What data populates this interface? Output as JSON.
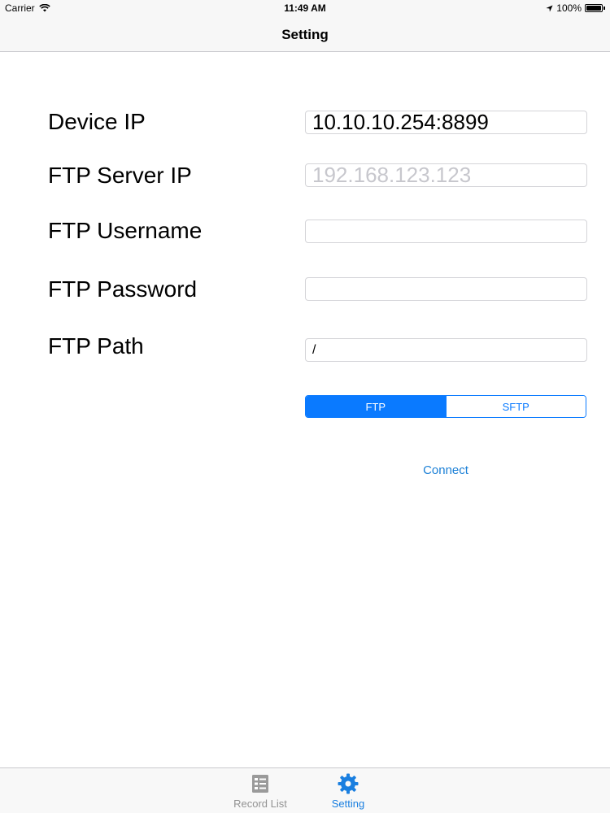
{
  "status_bar": {
    "carrier": "Carrier",
    "time": "11:49 AM",
    "battery": "100%",
    "battery_level": 1.0
  },
  "nav": {
    "title": "Setting"
  },
  "form": {
    "device_ip": {
      "label": "Device IP",
      "value": "10.10.10.254:8899",
      "placeholder": ""
    },
    "ftp_server_ip": {
      "label": "FTP Server IP",
      "value": "",
      "placeholder": "192.168.123.123"
    },
    "ftp_username": {
      "label": "FTP Username",
      "value": "",
      "placeholder": ""
    },
    "ftp_password": {
      "label": "FTP Password",
      "value": "",
      "placeholder": ""
    },
    "ftp_path": {
      "label": "FTP Path",
      "value": "/",
      "placeholder": ""
    }
  },
  "protocol": {
    "options": [
      "FTP",
      "SFTP"
    ],
    "selected": "FTP"
  },
  "connect_label": "Connect",
  "tab_bar": {
    "items": [
      {
        "label": "Record List",
        "icon": "list-icon",
        "active": false
      },
      {
        "label": "Setting",
        "icon": "gear-icon",
        "active": true
      }
    ]
  },
  "colors": {
    "accent": "#0a7aff",
    "tab_active": "#1a7fe0",
    "tab_inactive": "#929292"
  }
}
